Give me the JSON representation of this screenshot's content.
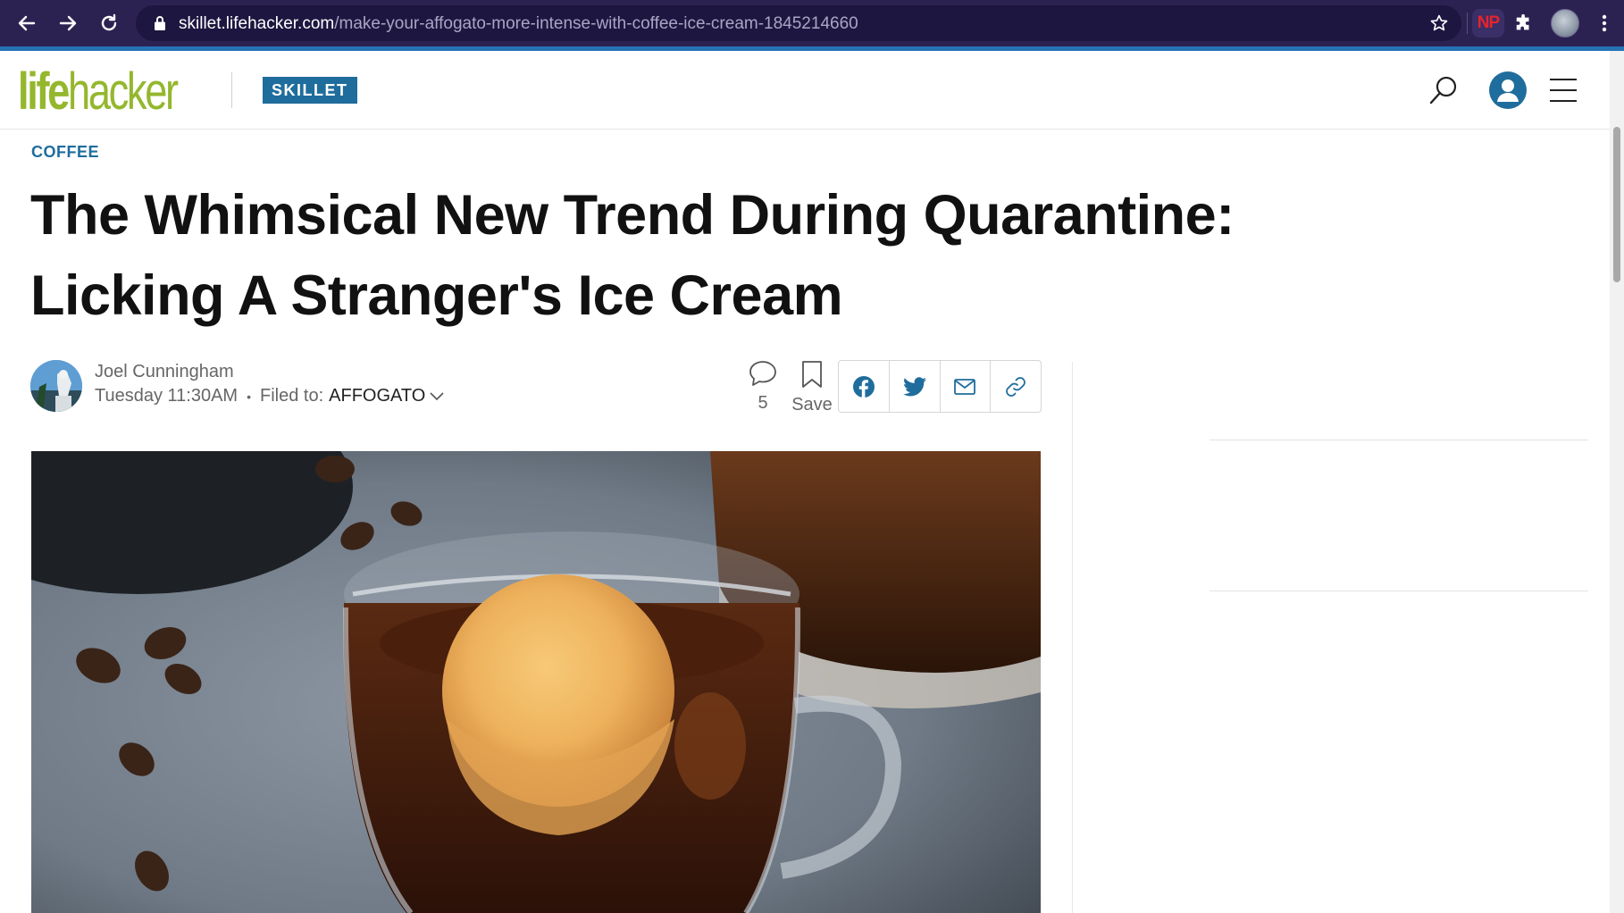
{
  "browser": {
    "url_host": "skillet.lifehacker.com",
    "url_path": "/make-your-affogato-more-intense-with-coffee-ice-cream-1845214660",
    "extension_np_label": "NP"
  },
  "site": {
    "logo_part1": "life",
    "logo_part2": "hacker",
    "section_badge": "SKILLET"
  },
  "article": {
    "category": "COFFEE",
    "headline": "The Whimsical New Trend During Quarantine: Licking A Stranger's Ice Cream",
    "author": "Joel Cunningham",
    "date": "Tuesday 11:30AM",
    "filed_to_label": "Filed to:",
    "filed_to_tag": "AFFOGATO",
    "comment_count": "5",
    "save_label": "Save"
  },
  "colors": {
    "chrome_bg": "#2c2252",
    "progress_bar": "#2573b5",
    "logo_green": "#94b72d",
    "accent_blue": "#1f6d9c"
  },
  "icons": [
    "back-arrow-icon",
    "forward-arrow-icon",
    "reload-icon",
    "lock-icon",
    "star-icon",
    "puzzle-icon",
    "kebab-menu-icon",
    "search-icon",
    "user-icon",
    "hamburger-menu-icon",
    "comment-bubble-icon",
    "bookmark-icon",
    "facebook-icon",
    "twitter-icon",
    "mail-icon",
    "link-icon",
    "chevron-down-icon"
  ]
}
